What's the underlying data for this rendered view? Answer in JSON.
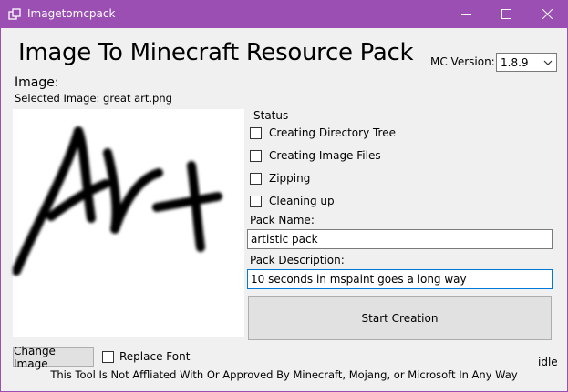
{
  "window": {
    "title": "Imagetomcpack",
    "accent": "#9b4fb2",
    "controls": [
      "minimize-icon",
      "maximize-icon",
      "close-icon"
    ]
  },
  "heading": "Image To Minecraft Resource Pack",
  "mc_version": {
    "label": "MC Version:",
    "selected": "1.8.9"
  },
  "image": {
    "label": "Image:",
    "selected_text": "Selected Image: great art.png"
  },
  "status": {
    "label": "Status",
    "steps": [
      {
        "label": "Creating Directory Tree",
        "checked": false
      },
      {
        "label": "Creating Image Files",
        "checked": false
      },
      {
        "label": "Zipping",
        "checked": false
      },
      {
        "label": "Cleaning up",
        "checked": false
      }
    ]
  },
  "pack_name": {
    "label": "Pack Name:",
    "value": "artistic pack"
  },
  "pack_description": {
    "label": "Pack Description:",
    "value": "10 seconds in mspaint goes a long way"
  },
  "buttons": {
    "start": "Start Creation",
    "change_image": "Change Image"
  },
  "replace_font": {
    "label": "Replace Font",
    "checked": false
  },
  "state": "idle",
  "disclaimer": "This Tool Is Not Affliated With Or Approved By Minecraft, Mojang, or Microsoft In Any Way"
}
